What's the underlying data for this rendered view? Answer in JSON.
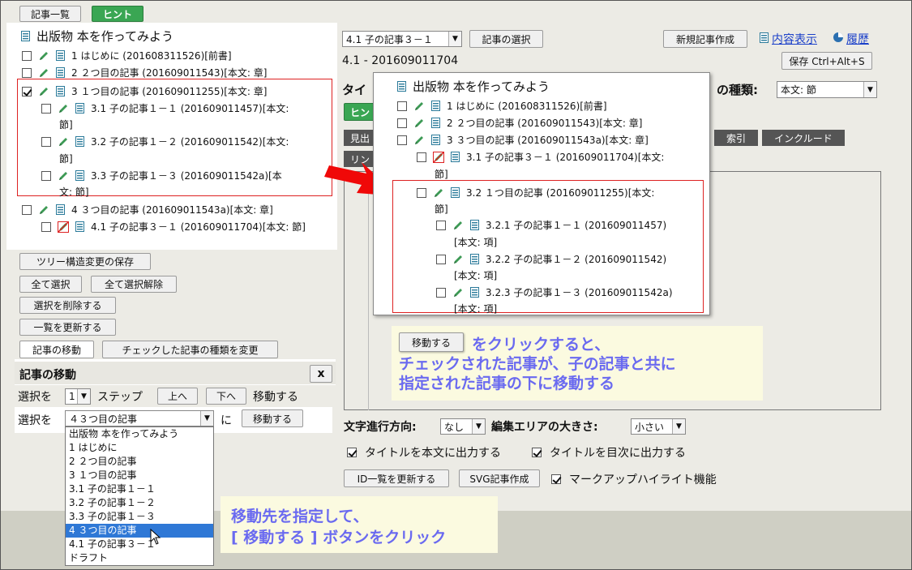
{
  "top_buttons": {
    "article_list": "記事一覧",
    "hint": "ヒント"
  },
  "tree_left": {
    "title": "出版物 本を作ってみよう",
    "items": [
      {
        "label": "1 はじめに (201608311526)[前書]"
      },
      {
        "label": "2 ２つ目の記事 (201609011543)[本文: 章]"
      },
      {
        "label": "3 １つ目の記事 (201609011255)[本文: 章]"
      },
      {
        "label": "3.1 子の記事１－１ (201609011457)[本文:",
        "cont": "節]"
      },
      {
        "label": "3.2 子の記事１－２ (201609011542)[本文:",
        "cont": "節]"
      },
      {
        "label": "3.3 子の記事１－３ (201609011542a)[本",
        "cont": "文: 節]"
      },
      {
        "label": "4 ３つ目の記事 (201609011543a)[本文: 章]"
      },
      {
        "label": "4.1 子の記事３－１ (201609011704)[本文: 節]"
      }
    ]
  },
  "left_buttons": {
    "save_tree": "ツリー構造変更の保存",
    "select_all": "全て選択",
    "deselect_all": "全て選択解除",
    "delete_selected": "選択を削除する",
    "refresh_list": "一覧を更新する",
    "move_article": "記事の移動",
    "change_type": "チェックした記事の種類を変更"
  },
  "move_panel": {
    "title": "記事の移動",
    "close": "x",
    "step_prefix": "選択を",
    "step_value": "1",
    "step_label": "ステップ",
    "up": "上へ",
    "down": "下へ",
    "move_do": "移動する",
    "target_prefix": "選択を",
    "target_value": "４３つ目の記事",
    "target_suffix": "に",
    "move_button": "移動する"
  },
  "dropdown": {
    "options": [
      "出版物 本を作ってみよう",
      "1 はじめに",
      "2 ２つ目の記事",
      "3 １つ目の記事",
      "3.1 子の記事１－１",
      "3.2 子の記事１－２",
      "3.3 子の記事１－３",
      "4 ３つ目の記事",
      "4.1 子の記事３－１",
      "ドラフト"
    ],
    "selected_index": 7
  },
  "callout_bottom": {
    "line1": "移動先を指定して、",
    "line2": "[ 移動する ] ボタンをクリック"
  },
  "right_header": {
    "article_select": "4.1 子の記事３－１",
    "select_button": "記事の選択",
    "new_article": "新規記事作成",
    "content_view": "内容表示",
    "history": "履歴",
    "article_id": "4.1 - 201609011704",
    "save": "保存 Ctrl+Alt+S",
    "title_label_partial": "タイ",
    "kind_label": "の種類:",
    "kind_value": "本文: 節",
    "hint_partial": "ヒン",
    "toolbar_partial1": "見出",
    "toolbar_partial2": "リン",
    "index": "索引",
    "include": "インクルード"
  },
  "tree_right": {
    "title": "出版物 本を作ってみよう",
    "items": [
      {
        "label": "1 はじめに (201608311526)[前書]"
      },
      {
        "label": "2 ２つ目の記事 (201609011543)[本文: 章]"
      },
      {
        "label": "3 ３つ目の記事 (201609011543a)[本文: 章]"
      },
      {
        "label": "3.1 子の記事３－１ (201609011704)[本文:",
        "cont": "節]"
      },
      {
        "label": "3.2 １つ目の記事 (201609011255)[本文:",
        "cont": "節]"
      },
      {
        "label": "3.2.1 子の記事１－１ (201609011457)",
        "cont": "[本文: 項]"
      },
      {
        "label": "3.2.2 子の記事１－２ (201609011542)",
        "cont": "[本文: 項]"
      },
      {
        "label": "3.2.3 子の記事１－３ (201609011542a)",
        "cont": "[本文: 項]"
      }
    ]
  },
  "callout_right": {
    "button": "移動する",
    "line1": "をクリックすると、",
    "line2": "チェックされた記事が、子の記事と共に",
    "line3": "指定された記事の下に移動する"
  },
  "bottom_controls": {
    "direction_label": "文字進行方向:",
    "direction_value": "なし",
    "area_label": "編集エリアの大きさ:",
    "area_value": "小さい",
    "title_body": "タイトルを本文に出力する",
    "title_toc": "タイトルを目次に出力する",
    "refresh_id": "ID一覧を更新する",
    "svg_create": "SVG記事作成",
    "markup_highlight": "マークアップハイライト機能"
  },
  "colors": {
    "accent_green": "#3aa653",
    "callout_blue": "#6a6af0",
    "red": "#d22222",
    "selected_blue": "#2f78d6"
  }
}
